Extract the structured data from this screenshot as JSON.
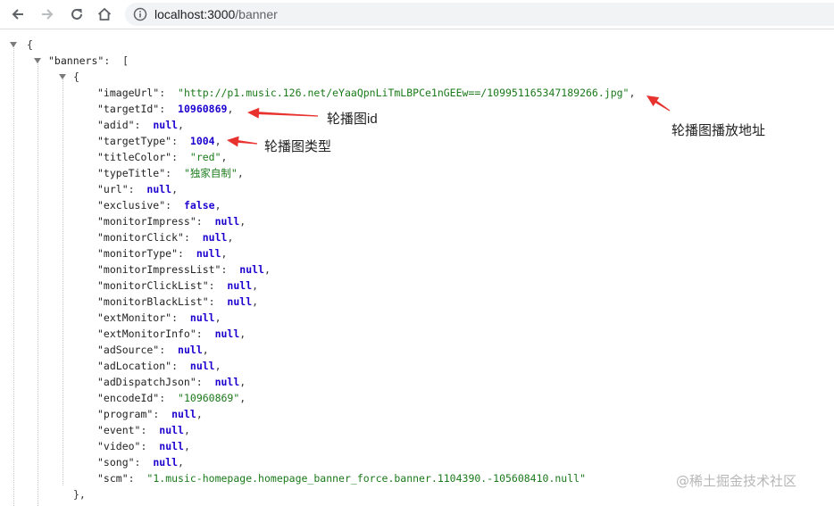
{
  "browser": {
    "url_host": "localhost:3000",
    "url_path": "/banner",
    "back_icon": "arrow-left-icon",
    "forward_icon": "arrow-right-icon",
    "reload_icon": "reload-icon",
    "home_icon": "home-icon",
    "info_icon": "info-circle-icon"
  },
  "json_view": {
    "root_open": "{",
    "banners_key": "\"banners\"",
    "colon": ":",
    "array_open": "[",
    "object_open": "{",
    "object_close": "},",
    "fields": [
      {
        "key": "\"imageUrl\"",
        "value": "\"http://p1.music.126.net/eYaaQpnLiTmLBPCe1nGEEw==/109951165347189266.jpg\"",
        "type": "str"
      },
      {
        "key": "\"targetId\"",
        "value": "10960869",
        "type": "num"
      },
      {
        "key": "\"adid\"",
        "value": "null",
        "type": "kw"
      },
      {
        "key": "\"targetType\"",
        "value": "1004",
        "type": "num"
      },
      {
        "key": "\"titleColor\"",
        "value": "\"red\"",
        "type": "str"
      },
      {
        "key": "\"typeTitle\"",
        "value": "\"独家自制\"",
        "type": "str"
      },
      {
        "key": "\"url\"",
        "value": "null",
        "type": "kw"
      },
      {
        "key": "\"exclusive\"",
        "value": "false",
        "type": "kw"
      },
      {
        "key": "\"monitorImpress\"",
        "value": "null",
        "type": "kw"
      },
      {
        "key": "\"monitorClick\"",
        "value": "null",
        "type": "kw"
      },
      {
        "key": "\"monitorType\"",
        "value": "null",
        "type": "kw"
      },
      {
        "key": "\"monitorImpressList\"",
        "value": "null",
        "type": "kw"
      },
      {
        "key": "\"monitorClickList\"",
        "value": "null",
        "type": "kw"
      },
      {
        "key": "\"monitorBlackList\"",
        "value": "null",
        "type": "kw"
      },
      {
        "key": "\"extMonitor\"",
        "value": "null",
        "type": "kw"
      },
      {
        "key": "\"extMonitorInfo\"",
        "value": "null",
        "type": "kw"
      },
      {
        "key": "\"adSource\"",
        "value": "null",
        "type": "kw"
      },
      {
        "key": "\"adLocation\"",
        "value": "null",
        "type": "kw"
      },
      {
        "key": "\"adDispatchJson\"",
        "value": "null",
        "type": "kw"
      },
      {
        "key": "\"encodeId\"",
        "value": "\"10960869\"",
        "type": "str"
      },
      {
        "key": "\"program\"",
        "value": "null",
        "type": "kw"
      },
      {
        "key": "\"event\"",
        "value": "null",
        "type": "kw"
      },
      {
        "key": "\"video\"",
        "value": "null",
        "type": "kw"
      },
      {
        "key": "\"song\"",
        "value": "null",
        "type": "kw"
      },
      {
        "key": "\"scm\"",
        "value": "\"1.music-homepage.homepage_banner_force.banner.1104390.-105608410.null\"",
        "type": "str",
        "last": true
      }
    ]
  },
  "annotations": {
    "image_url_label": "轮播图播放地址",
    "target_id_label": "轮播图id",
    "target_type_label": "轮播图类型",
    "arrow_color": "#e8322e"
  },
  "watermark": "@稀土掘金技术社区",
  "colors": {
    "string": "#1a7a1a",
    "number_keyword": "#1c00cf",
    "key": "#222222"
  }
}
